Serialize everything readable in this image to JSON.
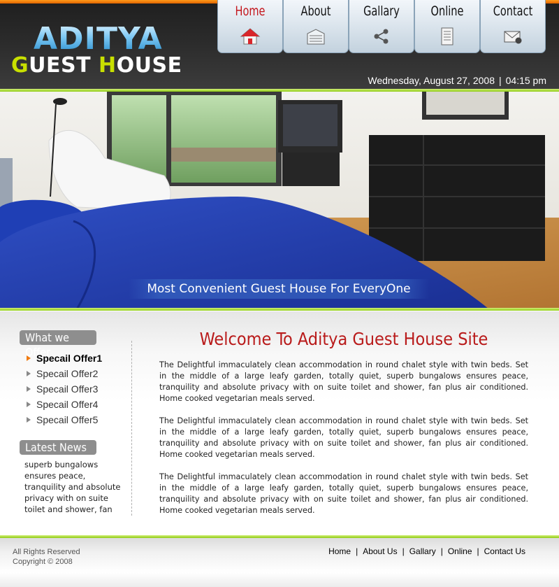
{
  "logo": {
    "line1": "ADITYA",
    "line2_first": "G",
    "line2_mid": "UEST ",
    "line2_h": "H",
    "line2_rest": "OUSE"
  },
  "nav": [
    {
      "label": "Home",
      "icon": "home-icon",
      "active": true
    },
    {
      "label": "About",
      "icon": "building-icon",
      "active": false
    },
    {
      "label": "Gallary",
      "icon": "share-icon",
      "active": false
    },
    {
      "label": "Online",
      "icon": "document-icon",
      "active": false
    },
    {
      "label": "Contact",
      "icon": "mail-icon",
      "active": false
    }
  ],
  "header": {
    "date": "Wednesday, August 27, 2008",
    "sep": "|",
    "time": "04:15 pm"
  },
  "hero": {
    "caption": "Most Convenient Guest House For EveryOne"
  },
  "sidebar": {
    "offers_title": "What we Offer",
    "offers": [
      "Specail Offer1",
      "Specail Offer2",
      "Specail Offer3",
      "Specail Offer4",
      "Specail Offer5"
    ],
    "news_title": "Latest News",
    "news_text": "superb bungalows ensures peace, tranquility and absolute privacy with on suite toilet and shower, fan"
  },
  "main": {
    "title": "Welcome To Aditya Guest House Site",
    "paragraphs": [
      "The Delightful immaculately clean accommodation in round chalet style with twin beds. Set in the middle of a large leafy garden, totally quiet, superb bungalows ensures peace, tranquility and absolute privacy with on suite toilet and shower, fan plus air conditioned. Home cooked vegetarian meals served.",
      "The Delightful immaculately clean accommodation in round chalet style with twin beds. Set in the middle of a large leafy garden, totally quiet, superb bungalows ensures peace, tranquility and absolute privacy with on suite toilet and shower, fan plus air conditioned. Home cooked vegetarian meals served.",
      "The Delightful immaculately clean accommodation in round chalet style with twin beds. Set in the middle of a large leafy garden, totally quiet, superb bungalows ensures peace, tranquility and absolute privacy with on suite toilet and shower, fan plus air conditioned. Home cooked vegetarian meals served."
    ]
  },
  "footer": {
    "rights": "All Rights Reserved",
    "copyright": "Copyright © 2008",
    "links": [
      "Home",
      "About Us",
      "Gallary",
      "Online",
      "Contact Us"
    ],
    "sep": "|"
  },
  "colors": {
    "accent_orange": "#f07a10",
    "accent_green": "#8fcc14",
    "title_red": "#b91b1b",
    "nav_active": "#c4161c"
  }
}
